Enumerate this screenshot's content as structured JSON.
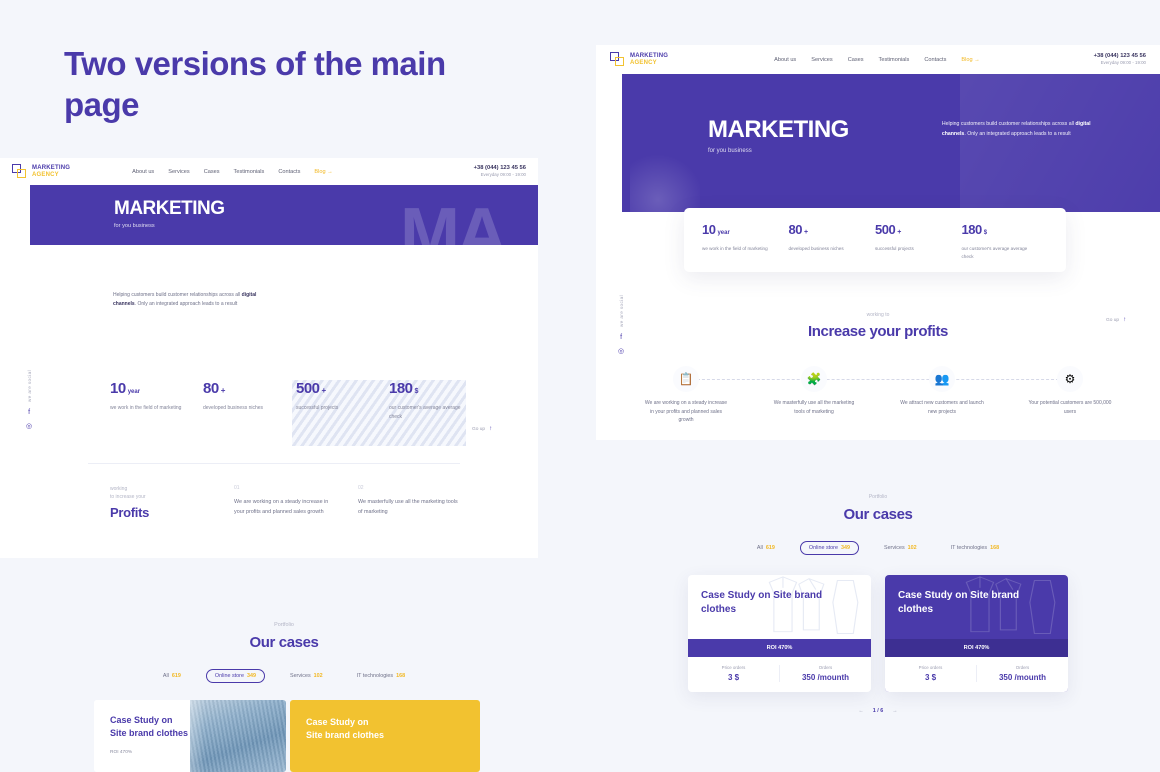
{
  "page": {
    "headline": "Two versions of the main page"
  },
  "brand": {
    "line1": "MARKETING",
    "line2": "AGENCY",
    "accent_purple": "#4a3aaa",
    "accent_yellow": "#f2c230"
  },
  "nav": {
    "items": [
      "About us",
      "Services",
      "Cases",
      "Testimonials",
      "Contacts"
    ],
    "blog": "Blog →"
  },
  "contact": {
    "phone": "+38 (044) 123 45 56",
    "hours": "Everyday  09:00 - 19:00"
  },
  "hero": {
    "ghost": "MA",
    "title": "MARKETING",
    "subtitle": "for you  business",
    "paragraph_1": "Helping customers build customer relationships across all ",
    "paragraph_bold": "digital channels",
    "paragraph_2": ". Only an integrated approach leads to a result"
  },
  "stats": [
    {
      "num": "10",
      "unit": "year",
      "desc": "we work in the field of marketing"
    },
    {
      "num": "80",
      "unit": "+",
      "desc": "developed business niches"
    },
    {
      "num": "500",
      "unit": "+",
      "desc": "successful projects"
    },
    {
      "num": "180",
      "unit": "$",
      "desc": "our customer's average average check"
    }
  ],
  "profits_section": {
    "eyebrow_line1": "working",
    "eyebrow_line2": "to increase your",
    "title": "Profits",
    "items": [
      {
        "num": "01",
        "text": "We are working on a steady increase in your profits and planned sales growth"
      },
      {
        "num": "02",
        "text": "We masterfully use all the marketing tools of marketing"
      }
    ]
  },
  "increase_section": {
    "eyebrow": "working to",
    "title": "Increase your profits",
    "features": [
      {
        "icon": "chart-report-icon",
        "glyph": "📋",
        "text": "We are working on a steady increase in your profits and planned sales growth"
      },
      {
        "icon": "network-tools-icon",
        "glyph": "🧩",
        "text": "We masterfully use all the marketing tools of marketing"
      },
      {
        "icon": "new-customers-icon",
        "glyph": "👥",
        "text": "We attract new customers and launch new projects"
      },
      {
        "icon": "audience-icon",
        "glyph": "⚙",
        "text": "Your potential customers are 500,000 users"
      }
    ]
  },
  "cases_section": {
    "eyebrow": "Portfolio",
    "title": "Our cases",
    "filters": [
      {
        "label": "All",
        "count": "619",
        "active": false
      },
      {
        "label": "Online store",
        "count": "349",
        "active": true
      },
      {
        "label": "Services",
        "count": "102",
        "active": false
      },
      {
        "label": "IT technologies",
        "count": "168",
        "active": false
      }
    ],
    "cards": [
      {
        "title": "Case Study on Site brand clothes",
        "roi": "ROI 470%",
        "metric_1_label": "Price orders",
        "metric_1_value": "3 $",
        "metric_2_label": "Orders",
        "metric_2_value": "350 /mounth",
        "style": "white"
      },
      {
        "title": "Case Study on Site brand clothes",
        "roi": "ROI 470%",
        "metric_1_label": "Price orders",
        "metric_1_value": "3 $",
        "metric_2_label": "Orders",
        "metric_2_value": "350 /mounth",
        "style": "purple"
      }
    ],
    "pager_prev": "←",
    "pager_current": "1 / 6",
    "pager_next": "→"
  },
  "bottom_cases": [
    {
      "title_line1": "Case Study on",
      "title_line2": "Site brand clothes",
      "roi": "ROI 470%",
      "style": "photo"
    },
    {
      "title_line1": "Case Study on",
      "title_line2": "Site brand clothes",
      "roi": "",
      "style": "yellow"
    }
  ],
  "rail": {
    "vertical_text": "we are social",
    "facebook": "f",
    "instagram": "◎"
  },
  "goup": {
    "label": "Go up",
    "arrow": "↑"
  }
}
